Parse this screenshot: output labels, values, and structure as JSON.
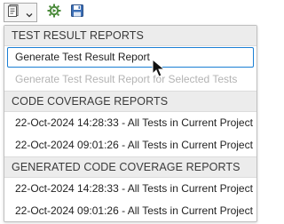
{
  "toolbar": {
    "report_button_icon": "report-document-icon",
    "dropdown_icon": "chevron-down-icon",
    "run_icon": "run-tests-icon",
    "save_icon": "save-icon"
  },
  "menu": {
    "sections": [
      {
        "header": "TEST RESULT REPORTS",
        "items": [
          {
            "label": "Generate Test Result Report",
            "state": "highlighted"
          },
          {
            "label": "Generate Test Result Report for Selected Tests",
            "state": "disabled"
          }
        ]
      },
      {
        "header": "CODE COVERAGE REPORTS",
        "items": [
          {
            "label": "22-Oct-2024 14:28:33 - All Tests in Current Project",
            "state": "enabled"
          },
          {
            "label": "22-Oct-2024 09:01:26 - All Tests in Current Project",
            "state": "enabled"
          }
        ]
      },
      {
        "header": "GENERATED CODE COVERAGE REPORTS",
        "items": [
          {
            "label": "22-Oct-2024 14:28:33 - All Tests in Current Project",
            "state": "enabled"
          },
          {
            "label": "22-Oct-2024 09:01:26 - All Tests in Current Project",
            "state": "enabled"
          }
        ]
      }
    ]
  },
  "colors": {
    "selection_border": "#1a7fd4",
    "header_background": "#ececec",
    "disabled_text": "#b3b3b3"
  }
}
